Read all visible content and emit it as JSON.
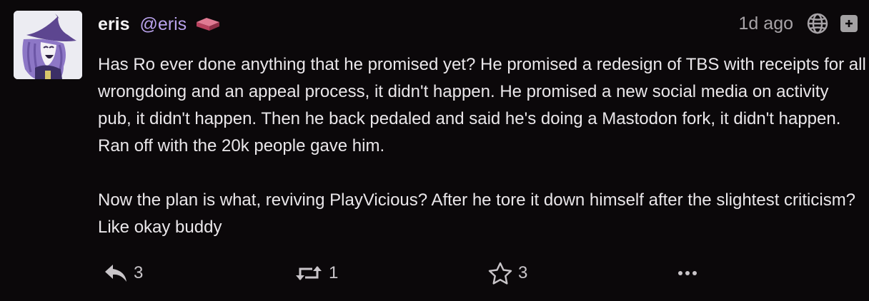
{
  "post": {
    "author": {
      "display_name": "eris",
      "handle": "@eris"
    },
    "timestamp": "1d ago",
    "content": {
      "paragraph_1": "Has Ro ever done anything that he promised yet? He promised a redesign of TBS with receipts for all wrongdoing and an appeal process, it didn't happen. He promised a new social media on activity pub, it didn't happen. Then he back pedaled and said he's doing a Mastodon fork, it didn't happen. Ran off with the 20k people gave him.",
      "paragraph_2": "Now the plan is what, reviving PlayVicious? After he tore it down himself after the slightest criticism? Like okay buddy"
    },
    "actions": {
      "reply_count": "3",
      "boost_count": "1",
      "favourite_count": "3"
    },
    "icons": {
      "badge": "brick-icon",
      "visibility": "globe-icon",
      "expand": "plus-square-icon",
      "reply": "reply-icon",
      "boost": "retweet-icon",
      "favourite": "star-icon",
      "more": "ellipsis-icon"
    },
    "colors": {
      "background": "#0b080a",
      "handle": "#b9a2ec",
      "text": "#eae7ea",
      "muted": "#a7a3a7",
      "badge": "#c94a67"
    }
  }
}
